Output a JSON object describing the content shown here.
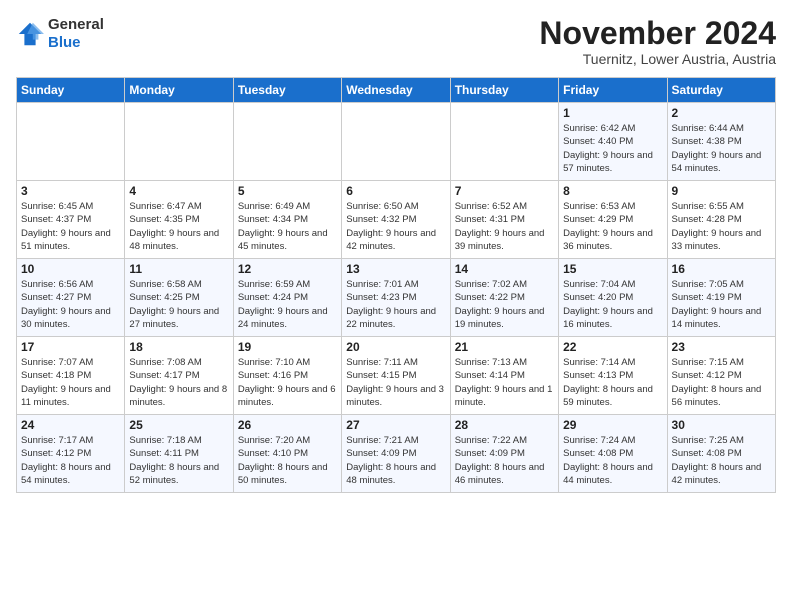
{
  "logo": {
    "line1": "General",
    "line2": "Blue"
  },
  "title": "November 2024",
  "location": "Tuernitz, Lower Austria, Austria",
  "days_of_week": [
    "Sunday",
    "Monday",
    "Tuesday",
    "Wednesday",
    "Thursday",
    "Friday",
    "Saturday"
  ],
  "weeks": [
    [
      {
        "day": "",
        "info": ""
      },
      {
        "day": "",
        "info": ""
      },
      {
        "day": "",
        "info": ""
      },
      {
        "day": "",
        "info": ""
      },
      {
        "day": "",
        "info": ""
      },
      {
        "day": "1",
        "info": "Sunrise: 6:42 AM\nSunset: 4:40 PM\nDaylight: 9 hours\nand 57 minutes."
      },
      {
        "day": "2",
        "info": "Sunrise: 6:44 AM\nSunset: 4:38 PM\nDaylight: 9 hours\nand 54 minutes."
      }
    ],
    [
      {
        "day": "3",
        "info": "Sunrise: 6:45 AM\nSunset: 4:37 PM\nDaylight: 9 hours\nand 51 minutes."
      },
      {
        "day": "4",
        "info": "Sunrise: 6:47 AM\nSunset: 4:35 PM\nDaylight: 9 hours\nand 48 minutes."
      },
      {
        "day": "5",
        "info": "Sunrise: 6:49 AM\nSunset: 4:34 PM\nDaylight: 9 hours\nand 45 minutes."
      },
      {
        "day": "6",
        "info": "Sunrise: 6:50 AM\nSunset: 4:32 PM\nDaylight: 9 hours\nand 42 minutes."
      },
      {
        "day": "7",
        "info": "Sunrise: 6:52 AM\nSunset: 4:31 PM\nDaylight: 9 hours\nand 39 minutes."
      },
      {
        "day": "8",
        "info": "Sunrise: 6:53 AM\nSunset: 4:29 PM\nDaylight: 9 hours\nand 36 minutes."
      },
      {
        "day": "9",
        "info": "Sunrise: 6:55 AM\nSunset: 4:28 PM\nDaylight: 9 hours\nand 33 minutes."
      }
    ],
    [
      {
        "day": "10",
        "info": "Sunrise: 6:56 AM\nSunset: 4:27 PM\nDaylight: 9 hours\nand 30 minutes."
      },
      {
        "day": "11",
        "info": "Sunrise: 6:58 AM\nSunset: 4:25 PM\nDaylight: 9 hours\nand 27 minutes."
      },
      {
        "day": "12",
        "info": "Sunrise: 6:59 AM\nSunset: 4:24 PM\nDaylight: 9 hours\nand 24 minutes."
      },
      {
        "day": "13",
        "info": "Sunrise: 7:01 AM\nSunset: 4:23 PM\nDaylight: 9 hours\nand 22 minutes."
      },
      {
        "day": "14",
        "info": "Sunrise: 7:02 AM\nSunset: 4:22 PM\nDaylight: 9 hours\nand 19 minutes."
      },
      {
        "day": "15",
        "info": "Sunrise: 7:04 AM\nSunset: 4:20 PM\nDaylight: 9 hours\nand 16 minutes."
      },
      {
        "day": "16",
        "info": "Sunrise: 7:05 AM\nSunset: 4:19 PM\nDaylight: 9 hours\nand 14 minutes."
      }
    ],
    [
      {
        "day": "17",
        "info": "Sunrise: 7:07 AM\nSunset: 4:18 PM\nDaylight: 9 hours\nand 11 minutes."
      },
      {
        "day": "18",
        "info": "Sunrise: 7:08 AM\nSunset: 4:17 PM\nDaylight: 9 hours\nand 8 minutes."
      },
      {
        "day": "19",
        "info": "Sunrise: 7:10 AM\nSunset: 4:16 PM\nDaylight: 9 hours\nand 6 minutes."
      },
      {
        "day": "20",
        "info": "Sunrise: 7:11 AM\nSunset: 4:15 PM\nDaylight: 9 hours\nand 3 minutes."
      },
      {
        "day": "21",
        "info": "Sunrise: 7:13 AM\nSunset: 4:14 PM\nDaylight: 9 hours\nand 1 minute."
      },
      {
        "day": "22",
        "info": "Sunrise: 7:14 AM\nSunset: 4:13 PM\nDaylight: 8 hours\nand 59 minutes."
      },
      {
        "day": "23",
        "info": "Sunrise: 7:15 AM\nSunset: 4:12 PM\nDaylight: 8 hours\nand 56 minutes."
      }
    ],
    [
      {
        "day": "24",
        "info": "Sunrise: 7:17 AM\nSunset: 4:12 PM\nDaylight: 8 hours\nand 54 minutes."
      },
      {
        "day": "25",
        "info": "Sunrise: 7:18 AM\nSunset: 4:11 PM\nDaylight: 8 hours\nand 52 minutes."
      },
      {
        "day": "26",
        "info": "Sunrise: 7:20 AM\nSunset: 4:10 PM\nDaylight: 8 hours\nand 50 minutes."
      },
      {
        "day": "27",
        "info": "Sunrise: 7:21 AM\nSunset: 4:09 PM\nDaylight: 8 hours\nand 48 minutes."
      },
      {
        "day": "28",
        "info": "Sunrise: 7:22 AM\nSunset: 4:09 PM\nDaylight: 8 hours\nand 46 minutes."
      },
      {
        "day": "29",
        "info": "Sunrise: 7:24 AM\nSunset: 4:08 PM\nDaylight: 8 hours\nand 44 minutes."
      },
      {
        "day": "30",
        "info": "Sunrise: 7:25 AM\nSunset: 4:08 PM\nDaylight: 8 hours\nand 42 minutes."
      }
    ]
  ]
}
